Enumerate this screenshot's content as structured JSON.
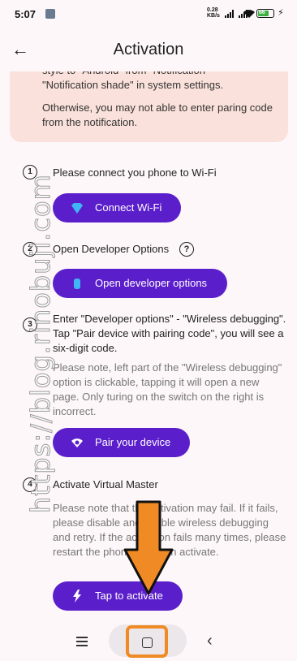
{
  "status_bar": {
    "time": "5:07",
    "net_speed_value": "0.28",
    "net_speed_unit": "KB/s",
    "battery": "66"
  },
  "app_bar": {
    "title": "Activation",
    "back_icon": "arrow-left-icon"
  },
  "warning": {
    "line_top": "style to \"Android\" from \"Notification\" -",
    "line_top2": "\"Notification shade\" in system settings.",
    "line_2": "Otherwise, you may not able to enter paring code from the notification."
  },
  "steps": [
    {
      "num": "1",
      "text": "Please connect you phone to Wi-Fi",
      "button": "Connect Wi-Fi"
    },
    {
      "num": "2",
      "text": "Open Developer Options",
      "button": "Open developer options"
    },
    {
      "num": "3",
      "text": "Enter \"Developer options\" - \"Wireless debugging\". Tap \"Pair device with pairing code\", you will see a six-digit code.",
      "note": "Please note, left part of the \"Wireless debugging\" option is clickable, tapping it will open a new page. Only turing on the switch on the right is incorrect.",
      "button": "Pair your device"
    },
    {
      "num": "4",
      "text": "Activate Virtual Master",
      "note": "Please note that the activation may fail. If it fails, please disable and enable wireless debugging and retry. If the activation fails many times, please restart the phone and then activate.",
      "button": "Tap to activate"
    }
  ],
  "watermark": "https://blog.rinobuji.com",
  "colors": {
    "accent": "#5b1ecb",
    "warning_bg": "#fbe1db",
    "annotation": "#f08a24"
  }
}
